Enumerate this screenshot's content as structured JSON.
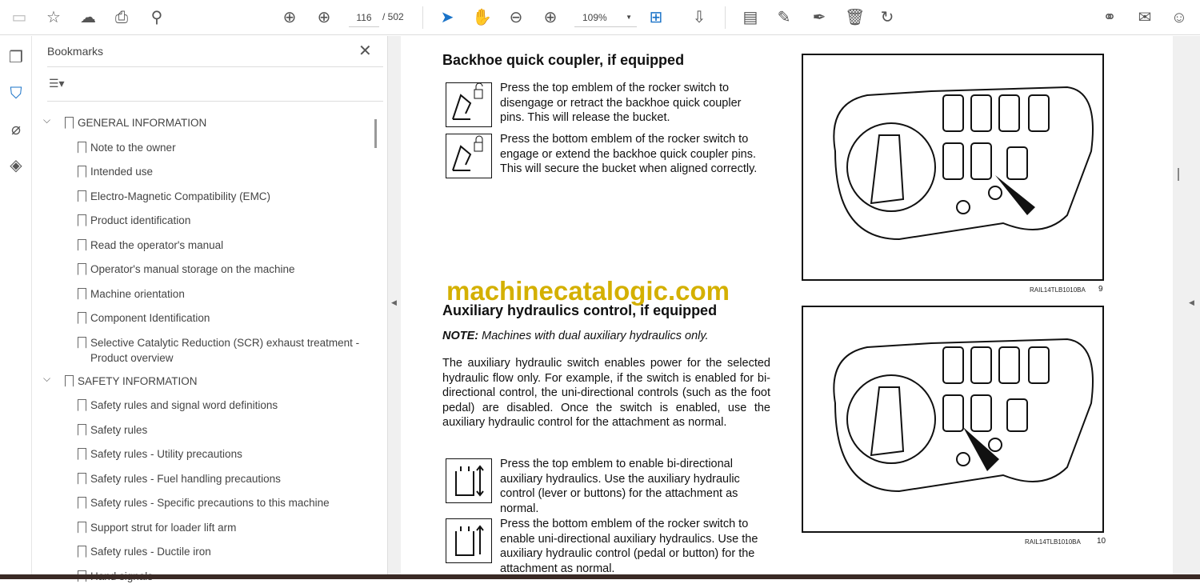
{
  "toolbar": {
    "current_page": "116",
    "total_pages": "/ 502",
    "zoom": "109%"
  },
  "bookmarks": {
    "title": "Bookmarks",
    "items": [
      {
        "label": "GENERAL INFORMATION",
        "level": 0
      },
      {
        "label": "Note to the owner",
        "level": 1
      },
      {
        "label": "Intended use",
        "level": 1
      },
      {
        "label": "Electro-Magnetic Compatibility (EMC)",
        "level": 1
      },
      {
        "label": "Product identification",
        "level": 1
      },
      {
        "label": "Read the operator's manual",
        "level": 1
      },
      {
        "label": "Operator's manual storage on the machine",
        "level": 1
      },
      {
        "label": "Machine orientation",
        "level": 1
      },
      {
        "label": "Component Identification",
        "level": 1
      },
      {
        "label": "Selective Catalytic Reduction (SCR) exhaust treatment - Product overview",
        "level": 1
      },
      {
        "label": "SAFETY INFORMATION",
        "level": 0
      },
      {
        "label": "Safety rules and signal word definitions",
        "level": 1
      },
      {
        "label": "Safety rules",
        "level": 1
      },
      {
        "label": "Safety rules - Utility precautions",
        "level": 1
      },
      {
        "label": "Safety rules - Fuel handling precautions",
        "level": 1
      },
      {
        "label": "Safety rules - Specific precautions to this machine",
        "level": 1
      },
      {
        "label": "Support strut for loader lift arm",
        "level": 1
      },
      {
        "label": "Safety rules - Ductile iron",
        "level": 1
      },
      {
        "label": "Hand signals",
        "level": 1
      }
    ]
  },
  "document": {
    "heading1": "Backhoe quick coupler, if equipped",
    "p1": "Press the top emblem of the rocker switch to disengage or retract the backhoe quick coupler pins. This will release the bucket.",
    "p2": "Press the bottom emblem of the rocker switch to engage or extend the backhoe quick coupler pins. This will secure the bucket when aligned correctly.",
    "watermark": "machinecatalogic.com",
    "heading2": "Auxiliary hydraulics control, if equipped",
    "note_label": "NOTE:",
    "note": " Machines with dual auxiliary hydraulics only.",
    "p3": "The auxiliary hydraulic switch enables power for the selected hydraulic flow only. For example, if the switch is enabled for bi-directional control, the uni-directional controls (such as the foot pedal) are disabled. Once the switch is enabled, use the auxiliary hydraulic control for the attachment as normal.",
    "p4": "Press the top emblem to enable bi-directional auxiliary hydraulics. Use the auxiliary hydraulic control (lever or buttons) for the attachment as normal.",
    "p5": "Press the bottom emblem of the rocker switch to enable uni-directional auxiliary hydraulics. Use the auxiliary hydraulic control (pedal or button) for the attachment as normal.",
    "fig1_code": "RAIL14TLB1010BA",
    "fig1_num": "9",
    "fig2_code": "RAIL14TLB1010BA",
    "fig2_num": "10"
  }
}
